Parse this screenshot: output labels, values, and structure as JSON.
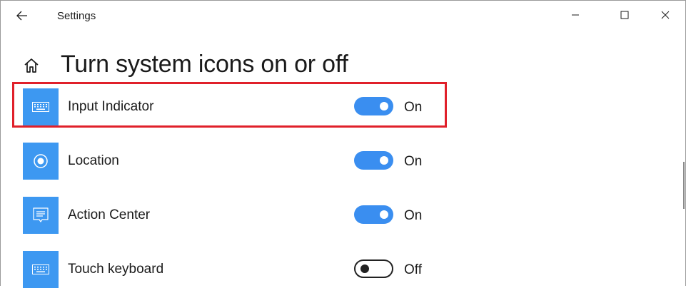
{
  "window": {
    "title": "Settings"
  },
  "page": {
    "title": "Turn system icons on or off"
  },
  "rows": [
    {
      "label": "Input Indicator",
      "state": "On",
      "on": true,
      "icon": "keyboard-icon"
    },
    {
      "label": "Location",
      "state": "On",
      "on": true,
      "icon": "location-icon"
    },
    {
      "label": "Action Center",
      "state": "On",
      "on": true,
      "icon": "action-center-icon"
    },
    {
      "label": "Touch keyboard",
      "state": "Off",
      "on": false,
      "icon": "keyboard-icon"
    }
  ],
  "colors": {
    "accent": "#3a8ef0",
    "icon_tile": "#3d98f1",
    "highlight": "#e0202a"
  }
}
